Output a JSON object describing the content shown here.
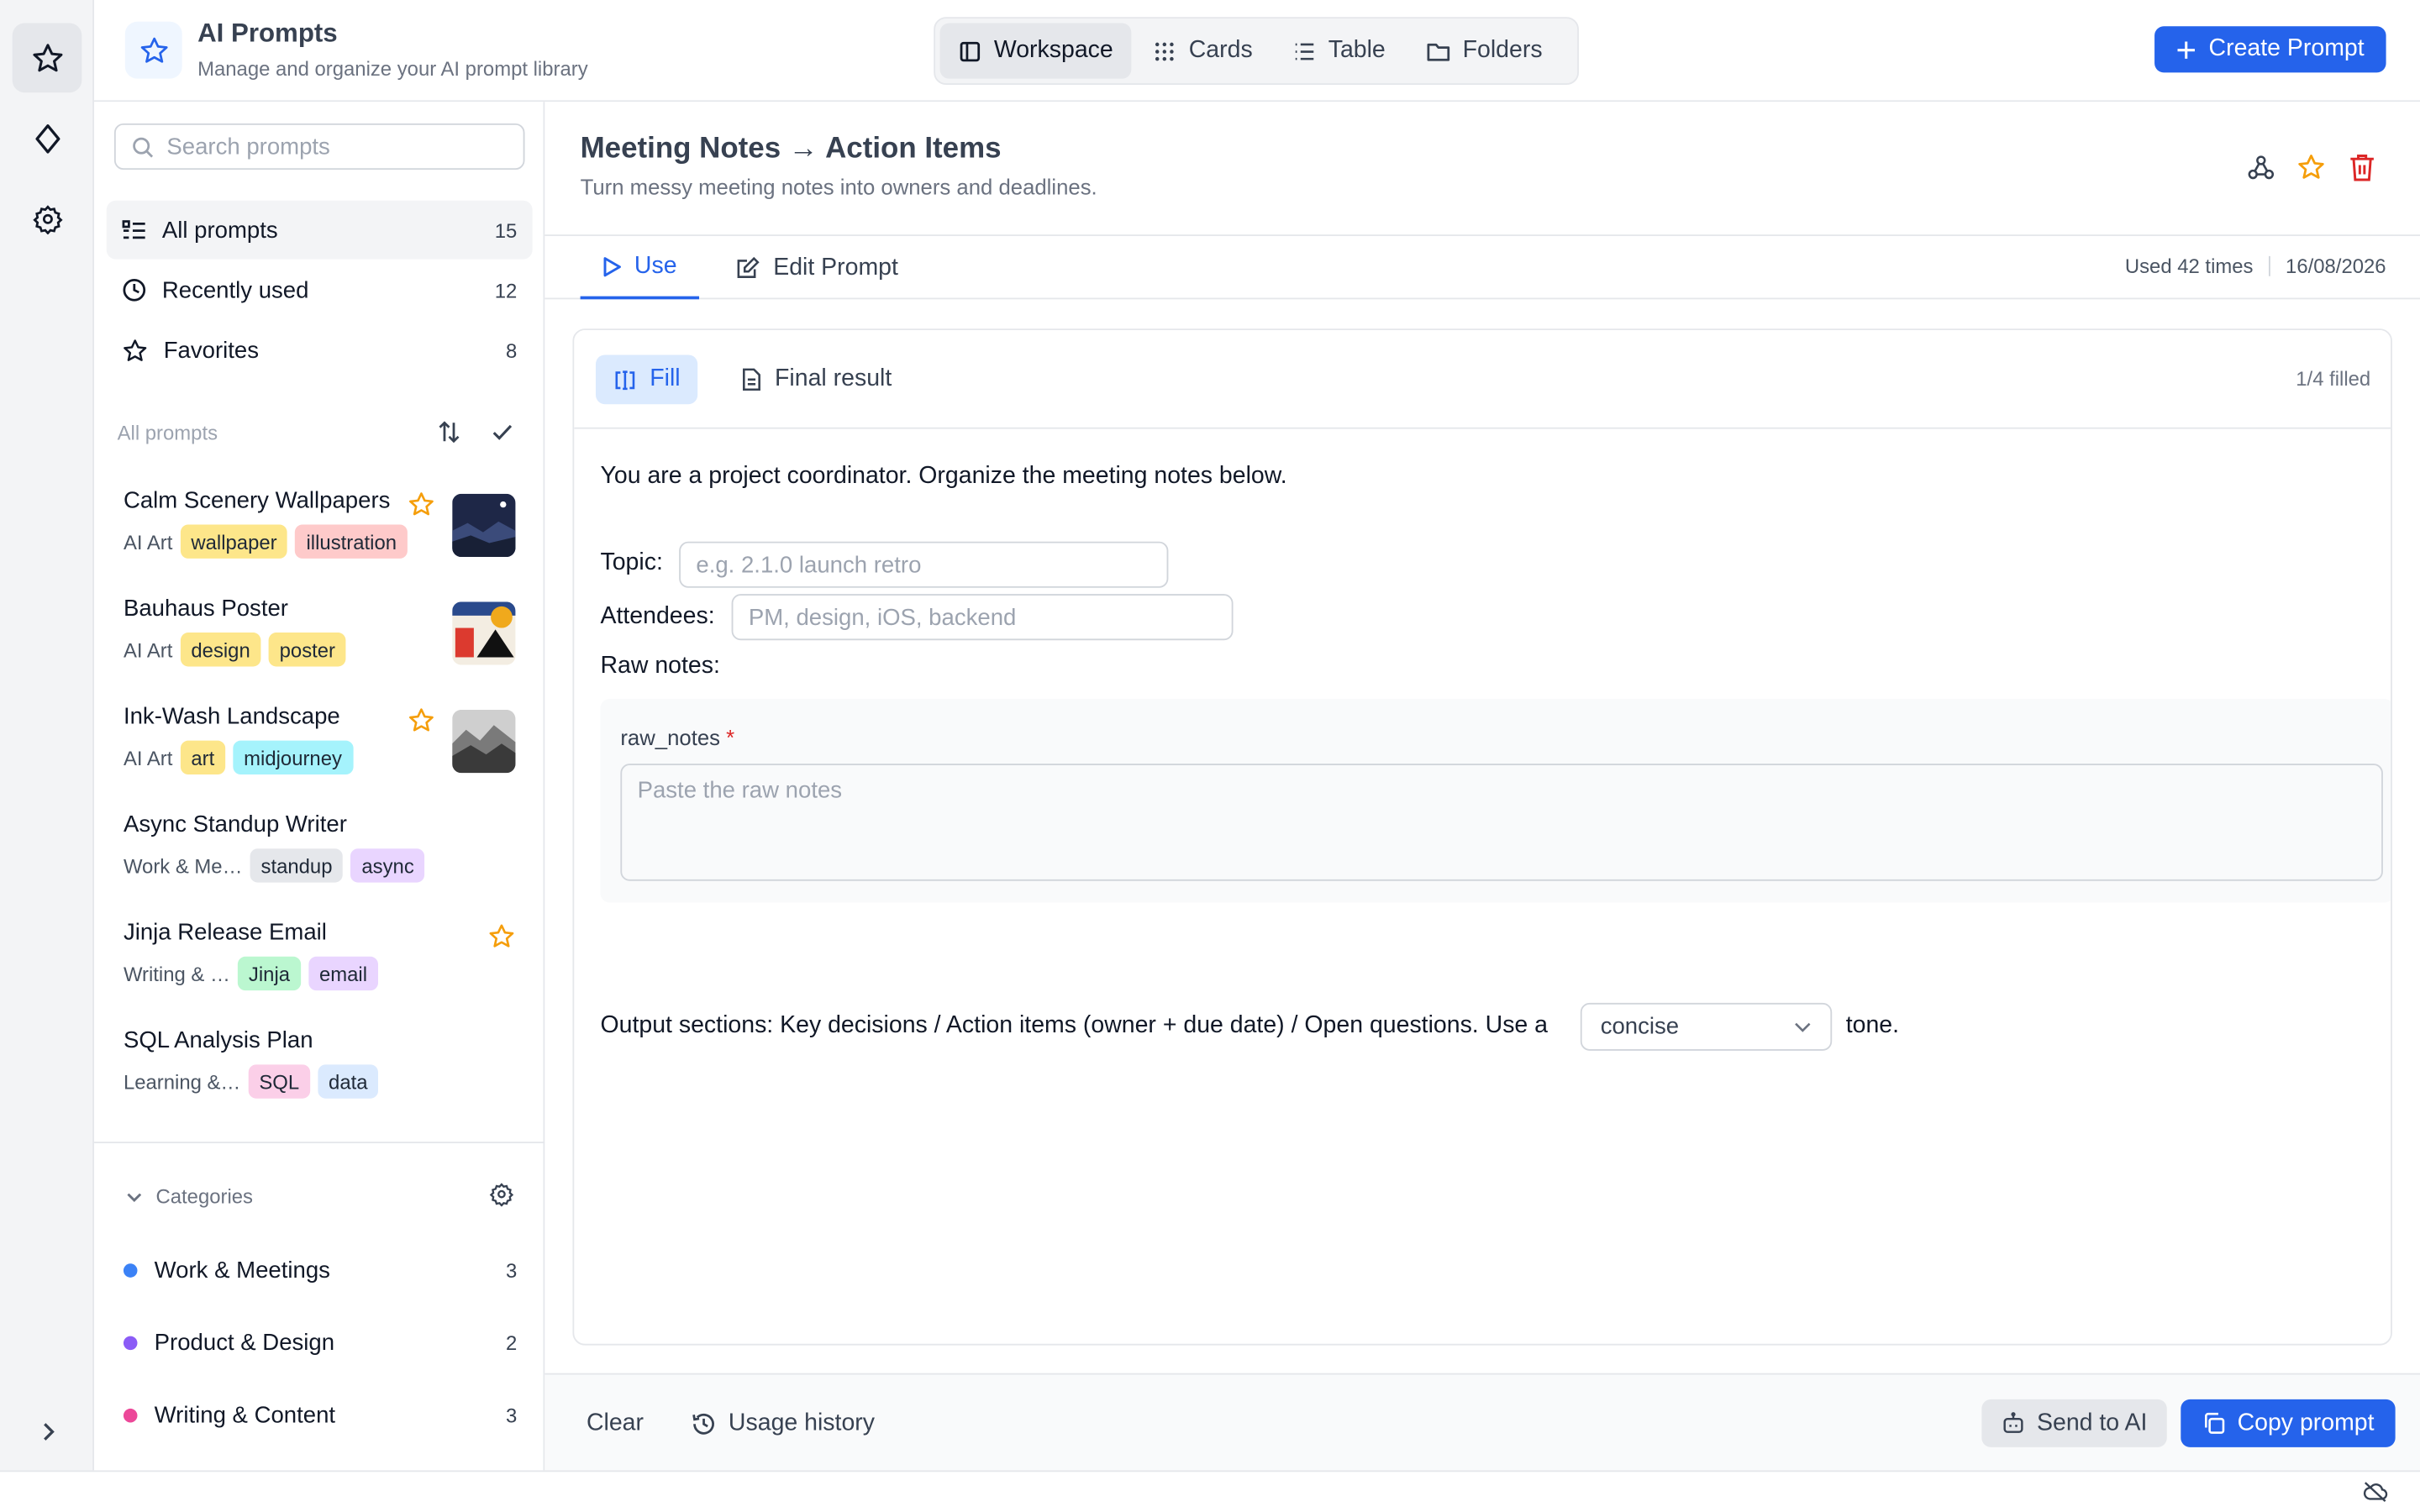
{
  "app": {
    "title": "AI Prompts",
    "subtitle": "Manage and organize your AI prompt library"
  },
  "view_switcher": [
    "Workspace",
    "Cards",
    "Table",
    "Folders"
  ],
  "create_button": "Create Prompt",
  "sidebar": {
    "search_placeholder": "Search prompts",
    "nav": [
      {
        "label": "All prompts",
        "count": "15"
      },
      {
        "label": "Recently used",
        "count": "12"
      },
      {
        "label": "Favorites",
        "count": "8"
      }
    ],
    "section_title": "All prompts",
    "prompts": [
      {
        "name": "Calm Scenery Wallpapers",
        "category": "AI Art",
        "tags": [
          "wallpaper",
          "illustration"
        ],
        "favorite": true
      },
      {
        "name": "Bauhaus Poster",
        "category": "AI Art",
        "tags": [
          "design",
          "poster"
        ],
        "favorite": false
      },
      {
        "name": "Ink-Wash Landscape",
        "category": "AI Art",
        "tags": [
          "art",
          "midjourney"
        ],
        "favorite": true
      },
      {
        "name": "Async Standup Writer",
        "category": "Work & Me…",
        "tags": [
          "standup",
          "async"
        ],
        "favorite": false
      },
      {
        "name": "Jinja Release Email",
        "category": "Writing & …",
        "tags": [
          "Jinja",
          "email"
        ],
        "favorite": true
      },
      {
        "name": "SQL Analysis Plan",
        "category": "Learning &…",
        "tags": [
          "SQL",
          "data"
        ],
        "favorite": false
      }
    ],
    "categories_title": "Categories",
    "categories": [
      {
        "label": "Work & Meetings",
        "count": "3",
        "color": "#3b82f6"
      },
      {
        "label": "Product & Design",
        "count": "2",
        "color": "#8b5cf6"
      },
      {
        "label": "Writing & Content",
        "count": "3",
        "color": "#ec4899"
      }
    ]
  },
  "prompt": {
    "title": "Meeting Notes → Action Items",
    "subtitle": "Turn messy meeting notes into owners and deadlines.",
    "tabs": [
      "Use",
      "Edit Prompt"
    ],
    "used": "Used 42 times",
    "date": "16/08/2026",
    "mode_tabs": [
      "Fill",
      "Final result"
    ],
    "filled": "1/4 filled",
    "intro": "You are a project coordinator. Organize the meeting notes below.",
    "topic_label": "Topic:",
    "topic_placeholder": "e.g. 2.1.0 launch retro",
    "attendees_label": "Attendees:",
    "attendees_placeholder": "PM, design, iOS, backend",
    "raw_label": "Raw notes:",
    "raw_var": "raw_notes",
    "raw_required": "*",
    "raw_placeholder": "Paste the raw notes",
    "output_text": "Output sections: Key decisions / Action items (owner + due date) / Open questions. Use a",
    "tone_value": "concise",
    "tone_suffix": "tone."
  },
  "footer": {
    "clear": "Clear",
    "history": "Usage history",
    "send": "Send to AI",
    "copy": "Copy prompt"
  },
  "colors": {
    "accent": "#2563eb",
    "favorite": "#f59e0b",
    "danger": "#dc2626"
  }
}
